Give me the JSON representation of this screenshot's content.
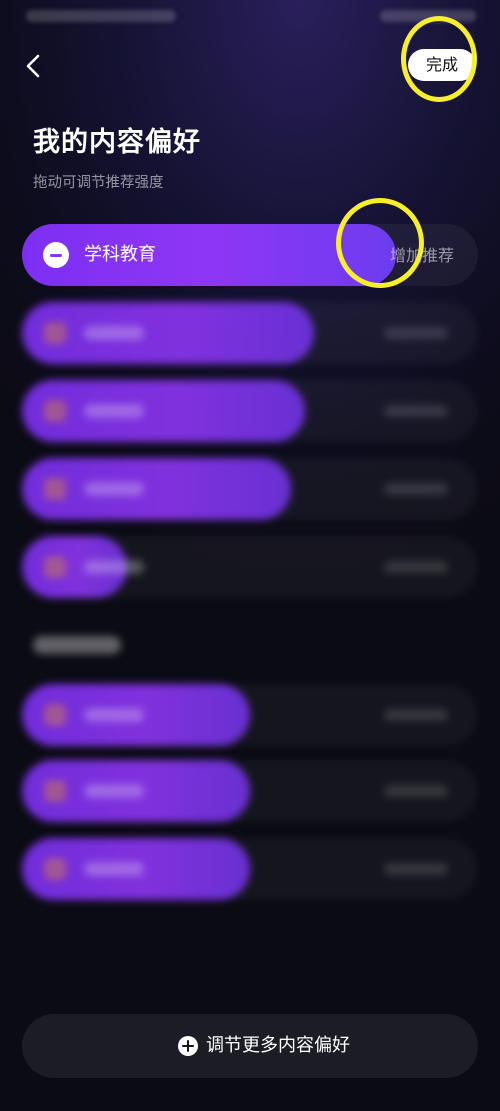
{
  "header": {
    "done_label": "完成",
    "title": "我的内容偏好",
    "subtitle": "拖动可调节推荐强度"
  },
  "preferences": [
    {
      "label": "学科教育",
      "action": "增加推荐",
      "level": 0.82,
      "active": true
    }
  ],
  "blurred_levels": [
    0.64,
    0.62,
    0.59,
    0.23,
    0.5,
    0.5,
    0.5
  ],
  "footer": {
    "more_label": "调节更多内容偏好"
  },
  "colors": {
    "accent": "#8a34f2",
    "highlight": "#f7ef2a",
    "background": "#0d0c1c"
  }
}
